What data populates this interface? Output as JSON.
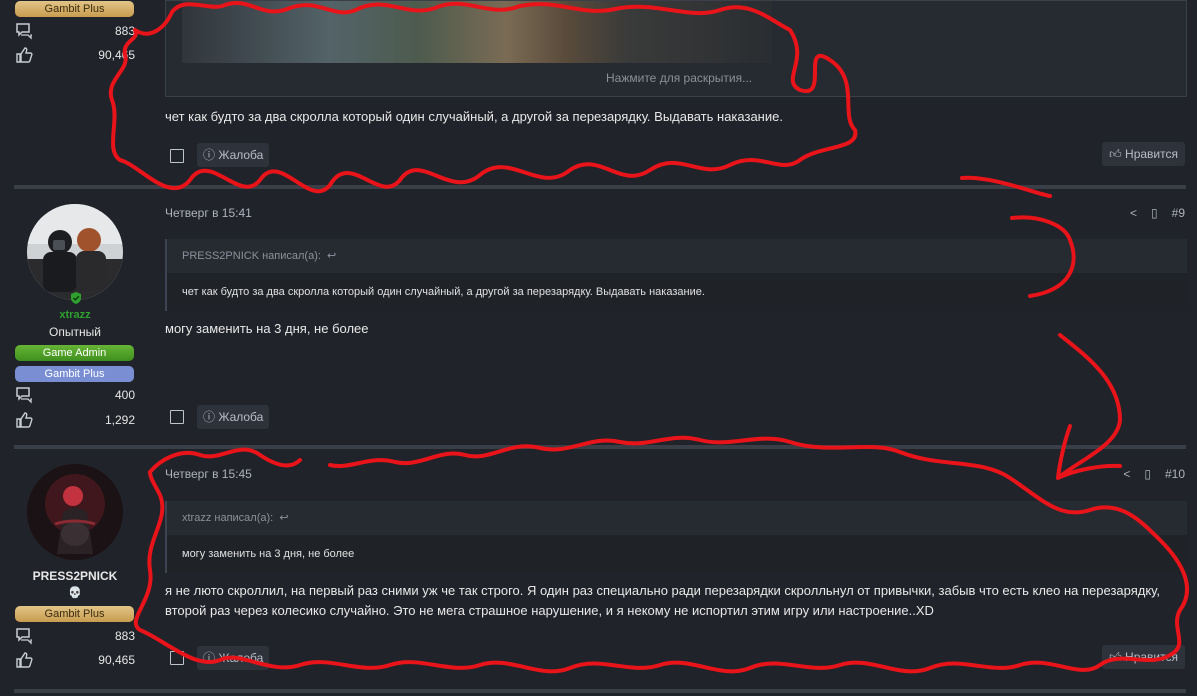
{
  "post_top": {
    "badge": "Gambit Plus",
    "messages": "883",
    "reactions": "90,465",
    "expand_text": "Нажмите для раскрытия...",
    "message": "чет как будто за два скролла который один случайный, а другой за перезарядку. Выдавать наказание.",
    "report_label": "Жалоба",
    "like_label": "Нравится"
  },
  "post_9": {
    "username": "xtrazz",
    "user_title": "Опытный",
    "badge_admin": "Game Admin",
    "badge_plus": "Gambit Plus",
    "messages": "400",
    "reactions": "1,292",
    "date": "Четверг в 15:41",
    "number": "#9",
    "quote_author": "PRESS2PNICK написал(а):",
    "quote_text": "чет как будто за два скролла который один случайный, а другой за перезарядку. Выдавать наказание.",
    "message": "могу заменить на 3 дня, не более",
    "report_label": "Жалоба"
  },
  "post_10": {
    "username": "PRESS2PNICK",
    "skull": "💀",
    "badge": "Gambit Plus",
    "messages": "883",
    "reactions": "90,465",
    "date": "Четверг в 15:45",
    "number": "#10",
    "quote_author": "xtrazz написал(а):",
    "quote_text": "могу заменить на 3 дня, не более",
    "message_line1": "я не люто скроллил, на первый раз сними уж че так строго. Я один раз специально ради перезарядки скролльнул от привычки, забыв что есть клео на перезарядку,",
    "message_line2": "второй раз через колесико случайно. Это не мега страшное нарушение, и я некому не испортил этим игру или настроение..XD",
    "report_label": "Жалоба",
    "like_label": "Нравится"
  },
  "colors": {
    "background": "#20232a",
    "username_green": "#2ea12e",
    "annotation_red": "#e8141a"
  }
}
